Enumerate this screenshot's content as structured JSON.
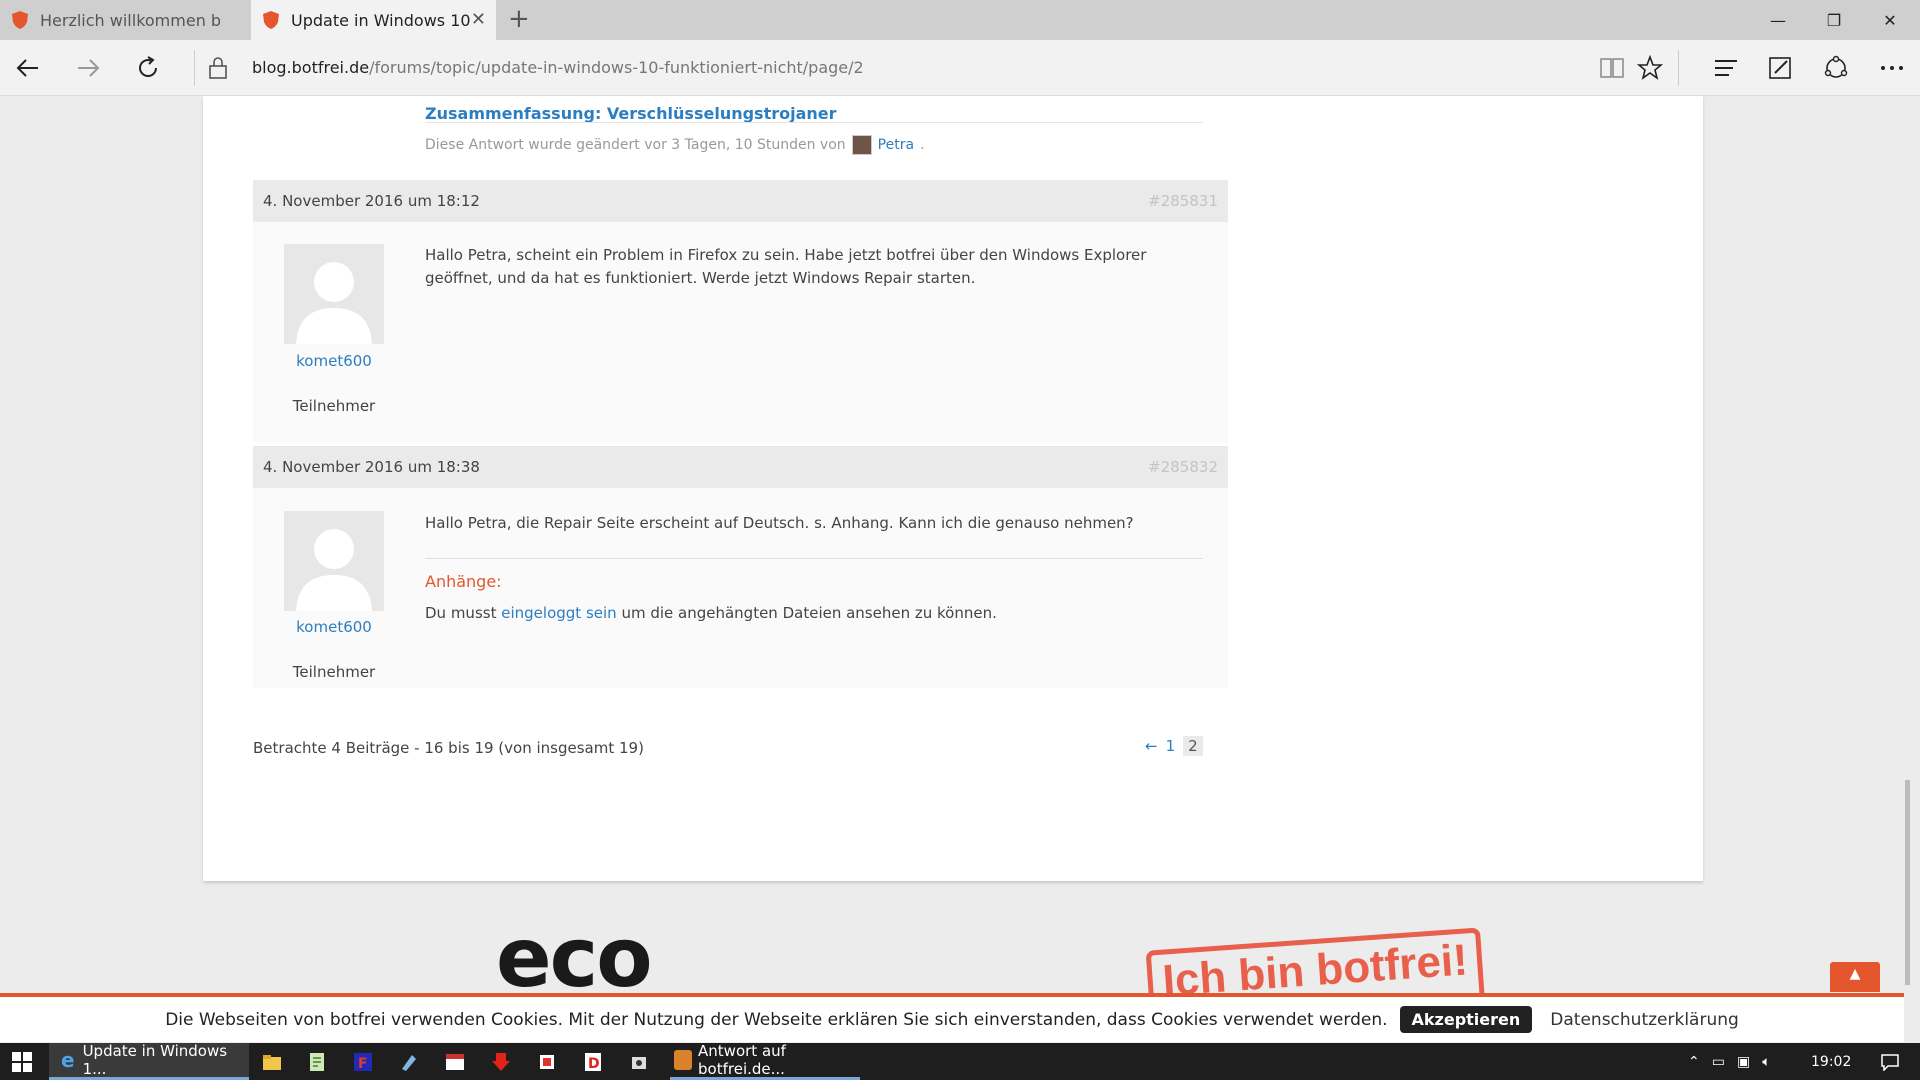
{
  "browser": {
    "tabs": [
      {
        "title": "Herzlich willkommen bei bo",
        "active": false
      },
      {
        "title": "Update in Windows 10 f",
        "active": true
      }
    ],
    "url_host": "blog.botfrei.de",
    "url_path": "/forums/topic/update-in-windows-10-funktioniert-nicht/page/2"
  },
  "page": {
    "related_link": "Zusammenfassung: Verschlüsselungstrojaner",
    "edited_note_prefix": "Diese Antwort wurde geändert vor 3 Tagen, 10 Stunden von",
    "edited_by": "Petra",
    "replies": [
      {
        "date": "4. November 2016 um 18:12",
        "id": "#285831",
        "author": "komet600",
        "role": "Teilnehmer",
        "text": "Hallo Petra, scheint ein Problem in Firefox zu sein. Habe jetzt botfrei über den Windows Explorer geöffnet, und da hat es funktioniert. Werde jetzt Windows Repair starten."
      },
      {
        "date": "4. November 2016 um 18:38",
        "id": "#285832",
        "author": "komet600",
        "role": "Teilnehmer",
        "text": "Hallo Petra, die Repair Seite erscheint auf Deutsch. s. Anhang. Kann ich die genauso nehmen?",
        "attachments_title": "Anhänge:",
        "attachments_prefix": "Du musst",
        "attachments_link": "eingeloggt sein",
        "attachments_suffix": "um die angehängten Dateien ansehen zu können."
      }
    ],
    "pagination_info": "Betrachte 4 Beiträge - 16 bis 19 (von insgesamt 19)",
    "pager": {
      "prev": "←",
      "page1": "1",
      "current": "2"
    },
    "footer_logo": "eco",
    "stamp_text": "Ich bin botfrei!"
  },
  "cookie": {
    "message": "Die Webseiten von botfrei verwenden Cookies. Mit der Nutzung der Webseite erklären Sie sich einverstanden, dass Cookies verwendet werden.",
    "accept": "Akzeptieren",
    "privacy": "Datenschutzerklärung"
  },
  "taskbar": {
    "browser_item": "Update in Windows 1...",
    "reply_item": "Antwort auf botfrei.de...",
    "clock": "19:02"
  },
  "colors": {
    "accent": "#e4572e",
    "link": "#2b7ec1"
  }
}
